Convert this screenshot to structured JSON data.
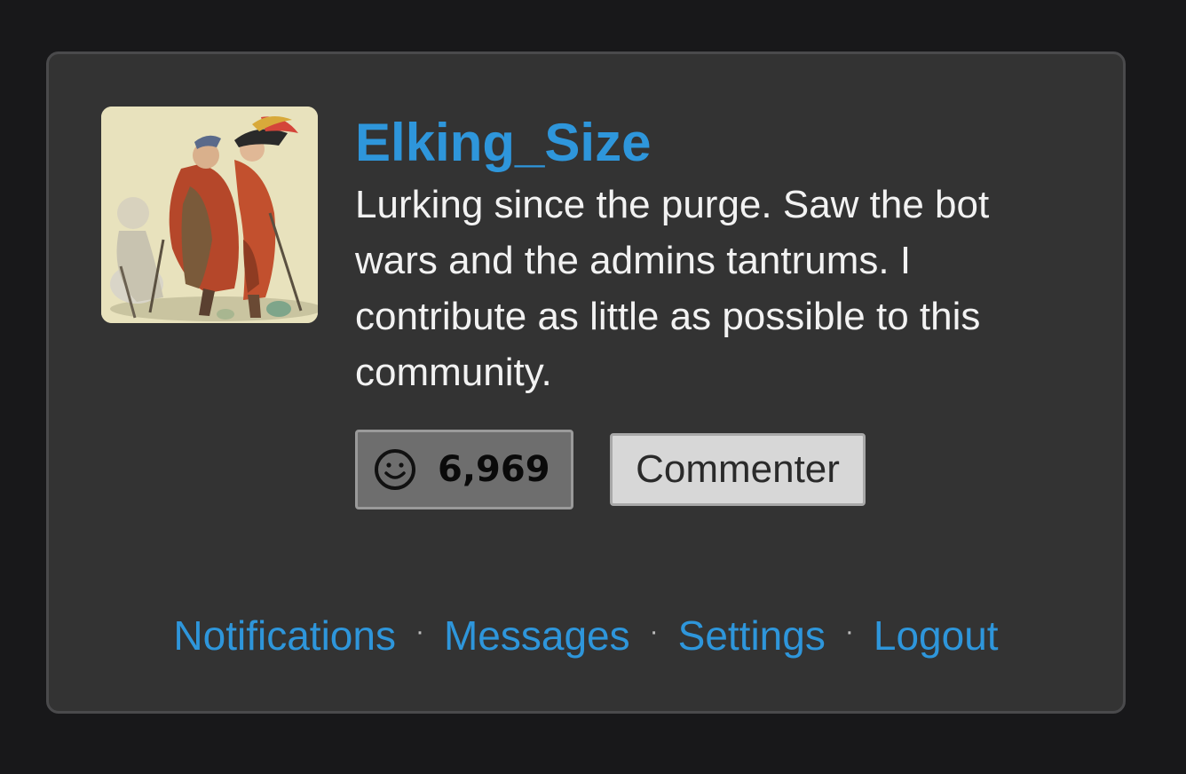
{
  "profile": {
    "username": "Elking_Size",
    "bio": "Lurking since the purge. Saw the bot wars and the admins tantrums. I contribute as little as possible to this community.",
    "karma": "6,969",
    "karma_icon": "smiley-icon",
    "role": "Commenter"
  },
  "nav": {
    "notifications": "Notifications",
    "messages": "Messages",
    "settings": "Settings",
    "logout": "Logout",
    "separator": "·"
  },
  "colors": {
    "background": "#18181a",
    "card": "#333333",
    "link": "#2e96db",
    "text": "#f2f2f2"
  }
}
